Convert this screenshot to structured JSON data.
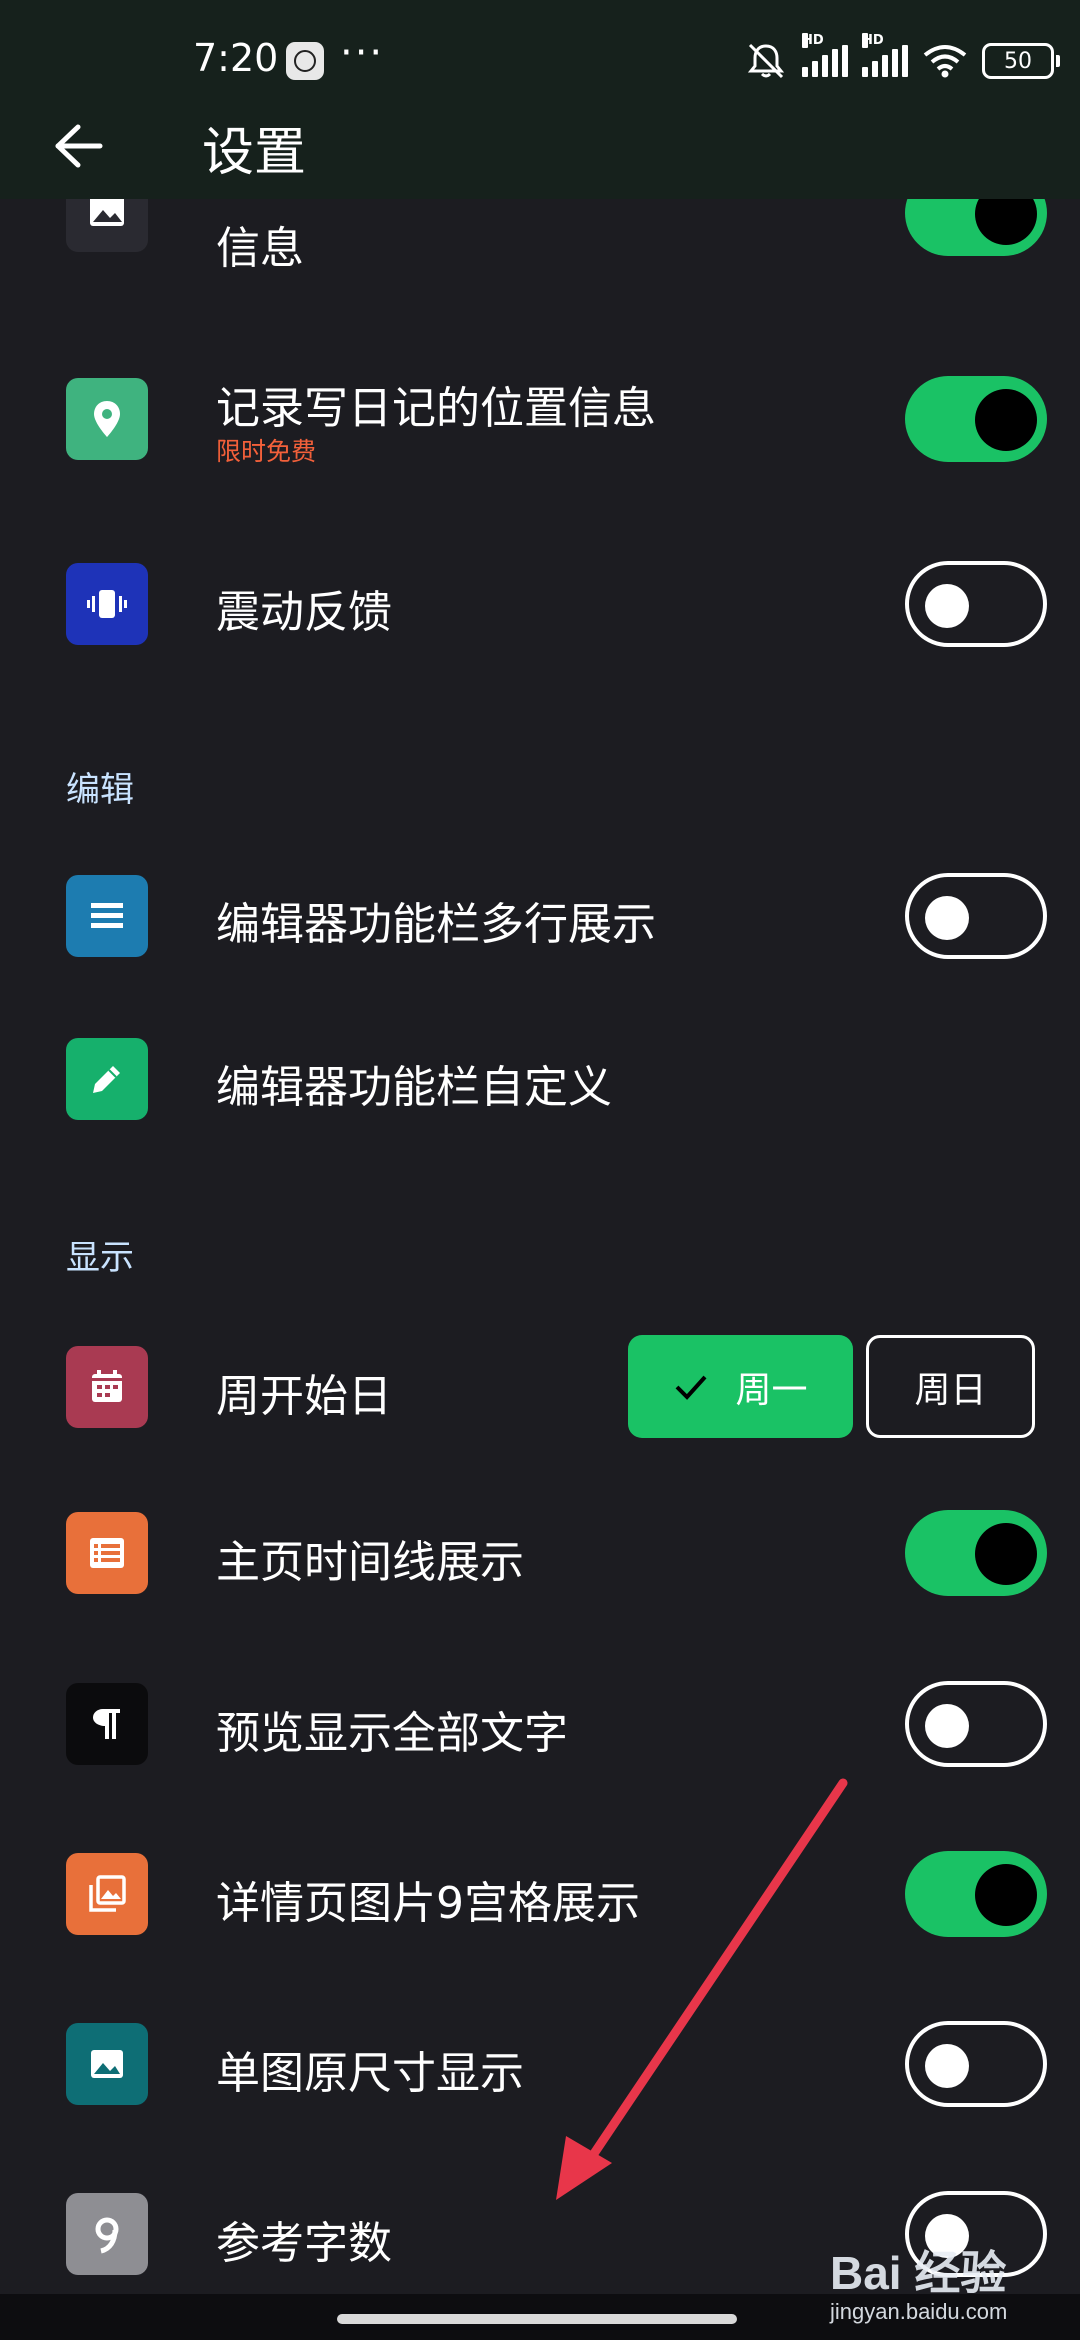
{
  "status_bar": {
    "time": "7:20",
    "more": "···",
    "hd1": "HD",
    "hd2": "HD",
    "battery": "50"
  },
  "header": {
    "title": "设置"
  },
  "rows": {
    "photo_info": {
      "label": "信息",
      "checked": true,
      "icon": "image-icon",
      "color": "#2a2a31"
    },
    "location": {
      "label": "记录写日记的位置信息",
      "sub": "限时免费",
      "checked": true,
      "icon": "location-pin-icon",
      "color": "#3fb37f"
    },
    "vibration": {
      "label": "震动反馈",
      "checked": false,
      "icon": "vibration-icon",
      "color": "#1e33b8"
    },
    "toolbar_multiline": {
      "label": "编辑器功能栏多行展示",
      "checked": false,
      "icon": "menu-lines-icon",
      "color": "#1d7cb0"
    },
    "toolbar_custom": {
      "label": "编辑器功能栏自定义",
      "icon": "pencil-icon",
      "color": "#16b06c"
    },
    "week_start": {
      "label": "周开始日",
      "options": [
        "周一",
        "周日"
      ],
      "selected": "周一",
      "icon": "calendar-icon",
      "color": "#a93a52"
    },
    "timeline": {
      "label": "主页时间线展示",
      "checked": true,
      "icon": "list-icon",
      "color": "#e8703a"
    },
    "preview_all": {
      "label": "预览显示全部文字",
      "checked": false,
      "icon": "paragraph-icon",
      "color": "#0b0b0d"
    },
    "grid9": {
      "label": "详情页图片9宫格展示",
      "checked": true,
      "icon": "photo-library-icon",
      "color": "#e8703a"
    },
    "single_image": {
      "label": "单图原尺寸显示",
      "checked": false,
      "icon": "image-icon",
      "color": "#0e6e75"
    },
    "word_count": {
      "label": "参考字数",
      "checked": false,
      "icon": "nine-icon",
      "color": "#8e8e93"
    }
  },
  "sections": {
    "edit": "编辑",
    "display": "显示"
  },
  "watermark": {
    "brand": "Bai 经验",
    "url": "jingyan.baidu.com"
  },
  "colors": {
    "accent_green": "#1ac265",
    "annotation_arrow": "#e8364a",
    "background": "#1c1c21"
  }
}
